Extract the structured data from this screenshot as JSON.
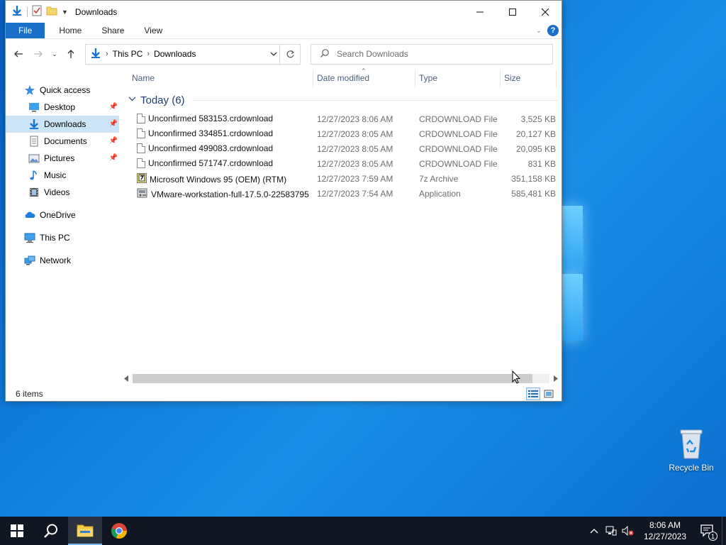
{
  "window": {
    "title": "Downloads",
    "ribbon_tabs": [
      "File",
      "Home",
      "Share",
      "View"
    ],
    "help_glyph": "?"
  },
  "address": {
    "breadcrumbs": [
      "This PC",
      "Downloads"
    ],
    "search_placeholder": "Search Downloads"
  },
  "navpane": {
    "quick_access": "Quick access",
    "items": [
      {
        "label": "Desktop",
        "icon": "desktop-icon",
        "pinned": true
      },
      {
        "label": "Downloads",
        "icon": "downloads-icon",
        "pinned": true,
        "selected": true
      },
      {
        "label": "Documents",
        "icon": "documents-icon",
        "pinned": true
      },
      {
        "label": "Pictures",
        "icon": "pictures-icon",
        "pinned": true
      },
      {
        "label": "Music",
        "icon": "music-icon",
        "pinned": false
      },
      {
        "label": "Videos",
        "icon": "videos-icon",
        "pinned": false
      }
    ],
    "onedrive": "OneDrive",
    "this_pc": "This PC",
    "network": "Network"
  },
  "columns": {
    "name": "Name",
    "date": "Date modified",
    "type": "Type",
    "size": "Size"
  },
  "group": {
    "label": "Today (6)"
  },
  "files": [
    {
      "name": "Unconfirmed 583153.crdownload",
      "date": "12/27/2023 8:06 AM",
      "type": "CRDOWNLOAD File",
      "size": "3,525 KB",
      "icon": "file-icon"
    },
    {
      "name": "Unconfirmed 334851.crdownload",
      "date": "12/27/2023 8:05 AM",
      "type": "CRDOWNLOAD File",
      "size": "20,127 KB",
      "icon": "file-icon"
    },
    {
      "name": "Unconfirmed 499083.crdownload",
      "date": "12/27/2023 8:05 AM",
      "type": "CRDOWNLOAD File",
      "size": "20,095 KB",
      "icon": "file-icon"
    },
    {
      "name": "Unconfirmed 571747.crdownload",
      "date": "12/27/2023 8:05 AM",
      "type": "CRDOWNLOAD File",
      "size": "831 KB",
      "icon": "file-icon"
    },
    {
      "name": "Microsoft Windows 95 (OEM) (RTM)",
      "date": "12/27/2023 7:59 AM",
      "type": "7z Archive",
      "size": "351,158 KB",
      "icon": "archive-icon"
    },
    {
      "name": "VMware-workstation-full-17.5.0-22583795",
      "date": "12/27/2023 7:54 AM",
      "type": "Application",
      "size": "585,481 KB",
      "icon": "installer-icon"
    }
  ],
  "status": {
    "item_count": "6 items"
  },
  "desktop": {
    "recycle_bin": "Recycle Bin"
  },
  "taskbar": {
    "time": "8:06 AM",
    "date": "12/27/2023",
    "notification_count": "1"
  },
  "colors": {
    "accent": "#1a6fc9",
    "selection": "#cce4f7",
    "taskbar": "#101722",
    "desktop": "#0f7ad8"
  }
}
